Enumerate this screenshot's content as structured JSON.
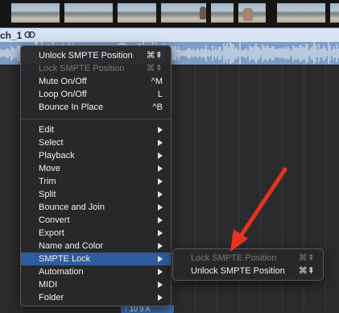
{
  "region": {
    "title": "ch_1",
    "loop_icon": "loop-icon",
    "color": "#d8e4f3"
  },
  "context_menu": {
    "items_top": [
      {
        "label": "Unlock SMPTE Position",
        "shortcut": "⌘⇞",
        "disabled": false
      },
      {
        "label": "Lock SMPTE Position",
        "shortcut": "⌘⇞",
        "disabled": true
      },
      {
        "label": "Mute On/Off",
        "shortcut": "^M",
        "disabled": false
      },
      {
        "label": "Loop On/Off",
        "shortcut": "L",
        "disabled": false
      },
      {
        "label": "Bounce In Place",
        "shortcut": "^B",
        "disabled": false
      }
    ],
    "items_sub": [
      {
        "label": "Edit"
      },
      {
        "label": "Select"
      },
      {
        "label": "Playback"
      },
      {
        "label": "Move"
      },
      {
        "label": "Trim"
      },
      {
        "label": "Split"
      },
      {
        "label": "Bounce and Join"
      },
      {
        "label": "Convert"
      },
      {
        "label": "Export"
      },
      {
        "label": "Name and Color"
      },
      {
        "label": "SMPTE Lock",
        "highlighted": true
      },
      {
        "label": "Automation"
      },
      {
        "label": "MIDI"
      },
      {
        "label": "Folder"
      }
    ]
  },
  "submenu": {
    "items": [
      {
        "label": "Lock SMPTE Position",
        "shortcut": "⌘⇞",
        "disabled": true
      },
      {
        "label": "Unlock SMPTE Position",
        "shortcut": "⌘⇞",
        "disabled": false
      }
    ]
  },
  "bottom_badge": "↑ 10  9  A",
  "colors": {
    "highlight": "#2e5c9e",
    "annotation_arrow": "#e8321f",
    "waveform": "#7e9dc3"
  }
}
